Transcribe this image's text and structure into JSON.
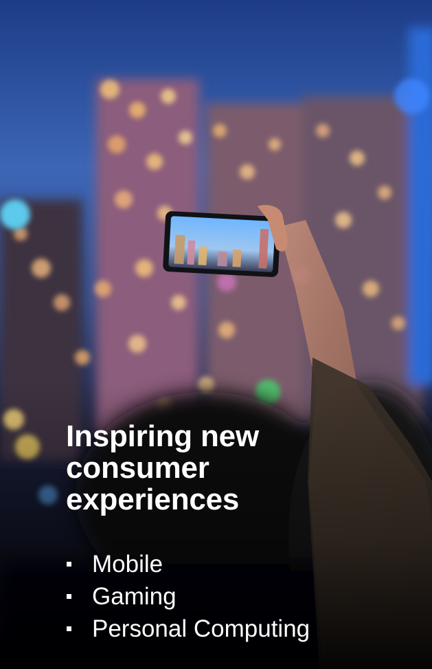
{
  "headline": {
    "line1": "Inspiring new",
    "line2": "consumer",
    "line3": "experiences"
  },
  "bullets": [
    {
      "label": "Mobile"
    },
    {
      "label": "Gaming"
    },
    {
      "label": "Personal Computing"
    }
  ],
  "colors": {
    "sky_top": "#1e3f8a",
    "sky_mid": "#3b66b8",
    "text": "#ffffff",
    "bokeh_warm": "#f2c27a",
    "bokeh_pink": "#d879c8",
    "bokeh_cyan": "#5fd9ff"
  }
}
